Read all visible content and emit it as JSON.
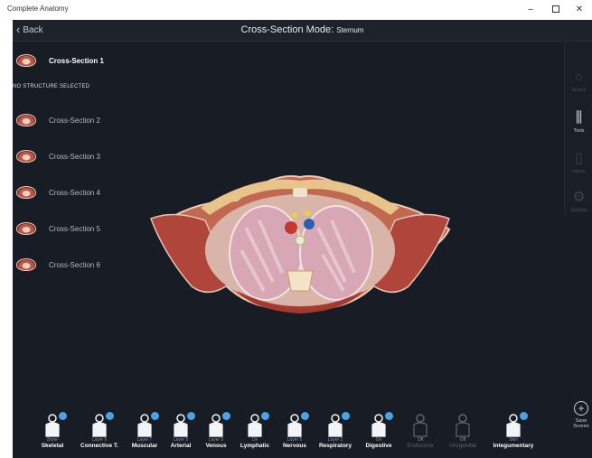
{
  "window": {
    "title": "Complete Anatomy",
    "controls": {
      "minimize": "–",
      "close": "✕"
    }
  },
  "header": {
    "back_label": "Back",
    "mode_title": "Cross-Section Mode:",
    "mode_subject": "Sternum"
  },
  "status": {
    "selection": "NO STRUCTURE SELECTED"
  },
  "sections": [
    {
      "label": "Cross-Section 1",
      "active": true
    },
    {
      "label": "Cross-Section 2",
      "active": false
    },
    {
      "label": "Cross-Section 3",
      "active": false
    },
    {
      "label": "Cross-Section 4",
      "active": false
    },
    {
      "label": "Cross-Section 5",
      "active": false
    },
    {
      "label": "Cross-Section 6",
      "active": false
    }
  ],
  "tools": [
    {
      "label": "Search",
      "icon": "search-icon",
      "enabled": false
    },
    {
      "label": "Tools",
      "icon": "pencils-icon",
      "enabled": true
    },
    {
      "label": "Library",
      "icon": "book-icon",
      "enabled": false
    },
    {
      "label": "Settings",
      "icon": "gear-icon",
      "enabled": false
    }
  ],
  "layers": [
    {
      "top": "Bone",
      "name": "Skeletal",
      "on": true
    },
    {
      "top": "Layer 6",
      "name": "Connective T.",
      "on": true
    },
    {
      "top": "Layer 7",
      "name": "Muscular",
      "on": true
    },
    {
      "top": "Layer 5",
      "name": "Arterial",
      "on": true
    },
    {
      "top": "Layer 5",
      "name": "Venous",
      "on": true
    },
    {
      "top": "On",
      "name": "Lymphatic",
      "on": true
    },
    {
      "top": "Layer 5",
      "name": "Nervous",
      "on": true
    },
    {
      "top": "Layer 2",
      "name": "Respiratory",
      "on": true
    },
    {
      "top": "On",
      "name": "Digestive",
      "on": true
    },
    {
      "top": "Off",
      "name": "Endocrine",
      "on": false
    },
    {
      "top": "Off",
      "name": "Urogenital",
      "on": false
    },
    {
      "top": "Skin",
      "name": "Integumentary",
      "on": true
    }
  ],
  "save_screen": {
    "line1": "Save",
    "line2": "Screen"
  },
  "colors": {
    "background": "#181c24",
    "accent": "#4aa3e8",
    "muscle": "#b8574a",
    "lung": "#d9a6b4"
  }
}
